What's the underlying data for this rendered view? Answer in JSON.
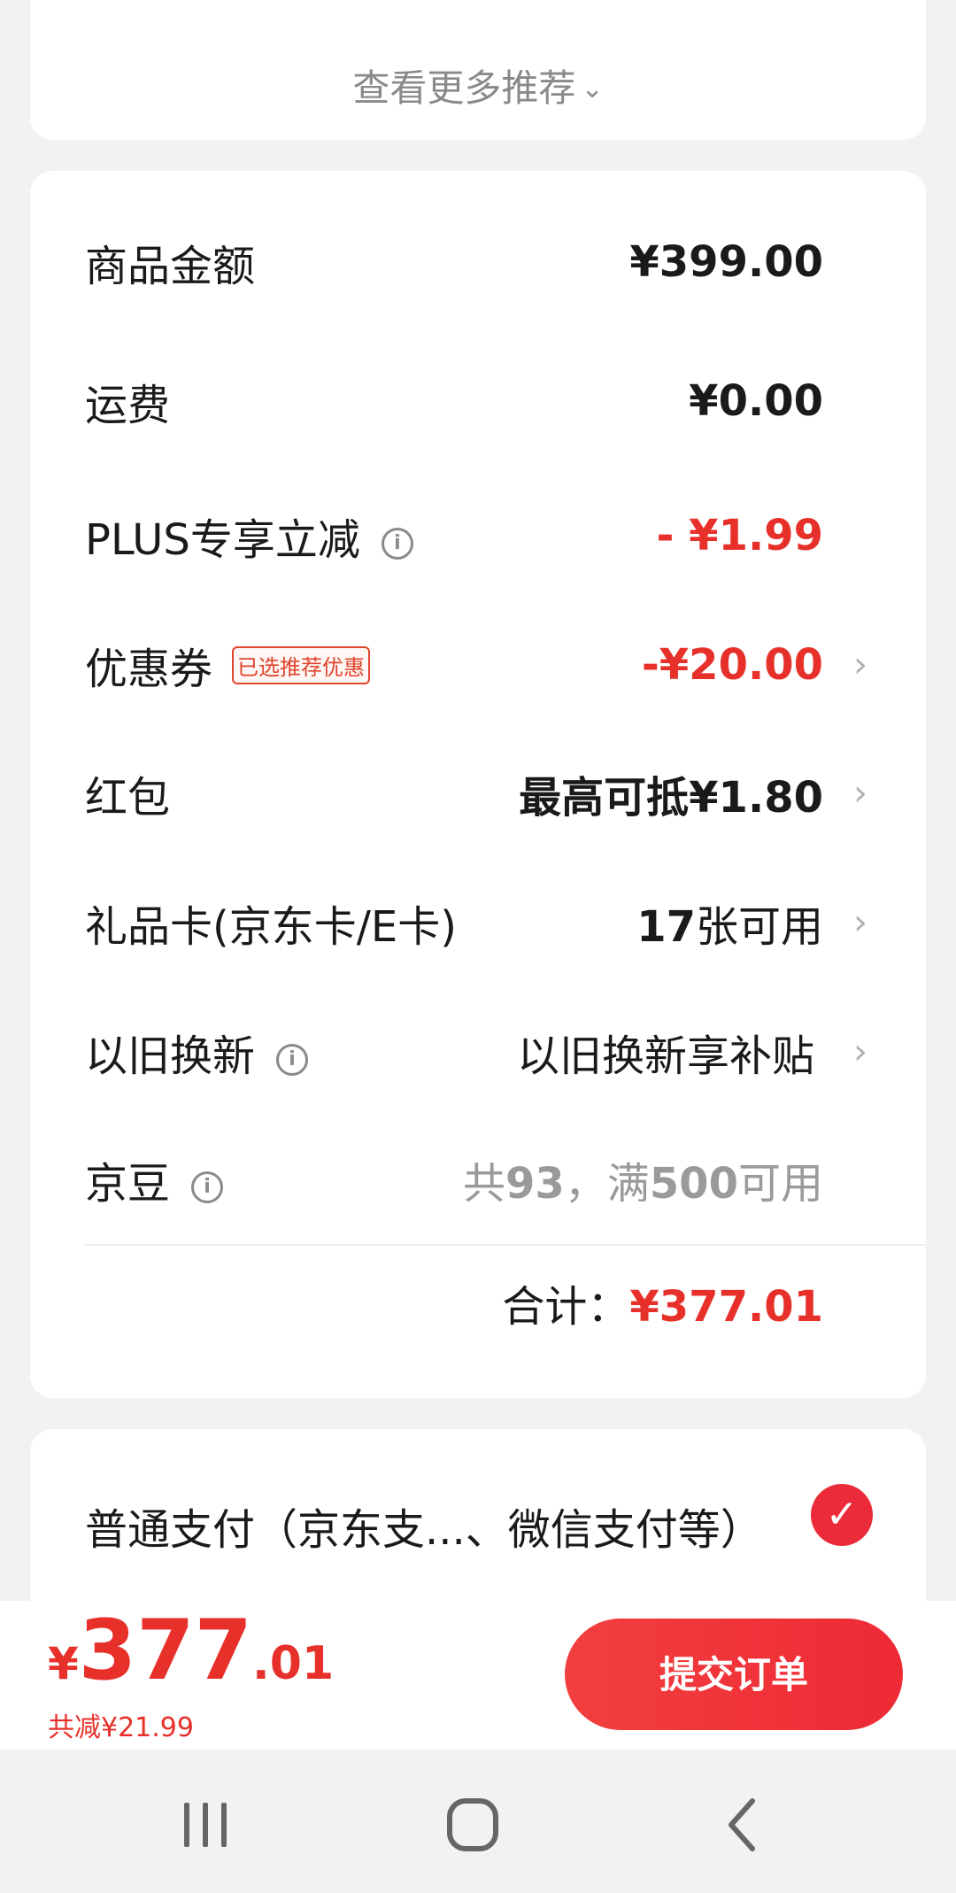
{
  "recommend": {
    "more_label": "查看更多推荐"
  },
  "summary": {
    "rows": [
      {
        "label": "商品金额",
        "value": "¥399.00"
      },
      {
        "label": "运费",
        "value": "¥0.00"
      },
      {
        "label": "PLUS专享立减",
        "value": "- ¥1.99"
      },
      {
        "label": "优惠券",
        "tag": "已选推荐优惠",
        "value": "-¥20.00"
      },
      {
        "label": "红包",
        "value": "最高可抵¥1.80"
      },
      {
        "label": "礼品卡(京东卡/E卡)",
        "value_bold": "17",
        "value_rest": "张可用"
      },
      {
        "label": "以旧换新",
        "value": "以旧换新享补贴"
      },
      {
        "label": "京豆",
        "value_pre": "共",
        "value_num1": "93",
        "value_mid": "，满",
        "value_num2": "500",
        "value_post": "可用"
      }
    ],
    "total_label": "合计：",
    "total_value": "¥377.01"
  },
  "payment": {
    "method_label": "普通支付（京东支...、微信支付等）"
  },
  "bottom": {
    "currency": "¥",
    "price_int": "377",
    "price_dec": ".01",
    "saved_label": "共减¥21.99",
    "submit_label": "提交订单"
  },
  "colors": {
    "accent_red": "#e8302a",
    "background": "#f2f2f2"
  }
}
